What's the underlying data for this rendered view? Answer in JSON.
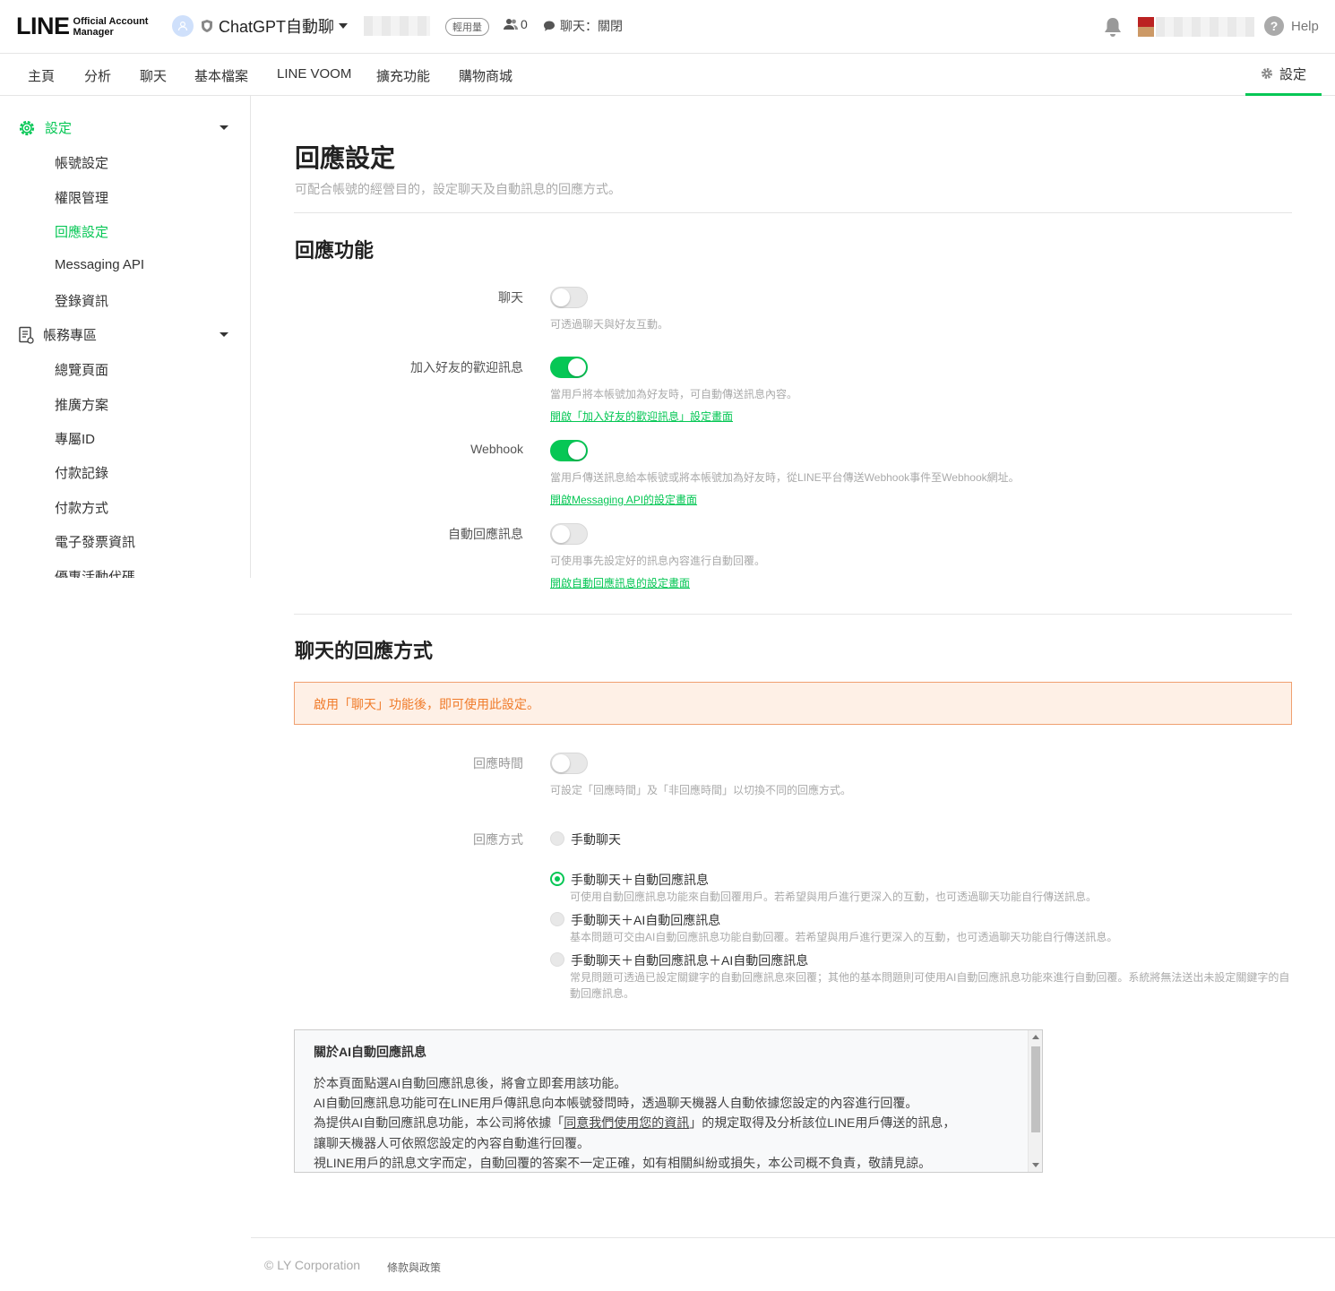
{
  "header": {
    "logo_main": "LINE",
    "logo_sub_1": "Official Account",
    "logo_sub_2": "Manager",
    "account_name": "ChatGPT自動聊",
    "plan_badge": "輕用量",
    "friends_count": "0",
    "chat_status": "聊天：關閉",
    "help_label": "Help"
  },
  "nav": {
    "items": [
      "主頁",
      "分析",
      "聊天",
      "基本檔案",
      "LINE VOOM",
      "擴充功能",
      "購物商城"
    ],
    "settings_label": "設定"
  },
  "sidebar": {
    "group1_label": "設定",
    "group1_items": [
      "帳號設定",
      "權限管理",
      "回應設定",
      "Messaging API",
      "登錄資訊"
    ],
    "group2_label": "帳務專區",
    "group2_items": [
      "總覽頁面",
      "推廣方案",
      "專屬ID",
      "付款記錄",
      "付款方式",
      "電子發票資訊",
      "優惠活動代碼"
    ]
  },
  "main": {
    "title": "回應設定",
    "description": "可配合帳號的經營目的，設定聊天及自動訊息的回應方式。",
    "section1_title": "回應功能",
    "chat_label": "聊天",
    "chat_on": false,
    "chat_help": "可透過聊天與好友互動。",
    "welcome_label": "加入好友的歡迎訊息",
    "welcome_on": true,
    "welcome_help": "當用戶將本帳號加為好友時，可自動傳送訊息內容。",
    "welcome_link": "開啟「加入好友的歡迎訊息」設定畫面",
    "webhook_label": "Webhook",
    "webhook_on": true,
    "webhook_help": "當用戶傳送訊息給本帳號或將本帳號加為好友時，從LINE平台傳送Webhook事件至Webhook網址。",
    "webhook_link": "開啟Messaging API的設定畫面",
    "auto_label": "自動回應訊息",
    "auto_on": false,
    "auto_help": "可使用事先設定好的訊息內容進行自動回覆。",
    "auto_link": "開啟自動回應訊息的設定畫面",
    "section2_title": "聊天的回應方式",
    "notice": "啟用「聊天」功能後，即可使用此設定。",
    "hours_label": "回應時間",
    "hours_on": false,
    "hours_help": "可設定「回應時間」及「非回應時間」以切換不同的回應方式。",
    "method_label": "回應方式",
    "options": [
      {
        "label": "手動聊天",
        "desc": "",
        "selected": false
      },
      {
        "label": "手動聊天＋自動回應訊息",
        "desc": "可使用自動回應訊息功能來自動回覆用戶。若希望與用戶進行更深入的互動，也可透過聊天功能自行傳送訊息。",
        "selected": true
      },
      {
        "label": "手動聊天＋AI自動回應訊息",
        "desc": "基本問題可交由AI自動回應訊息功能自動回覆。若希望與用戶進行更深入的互動，也可透過聊天功能自行傳送訊息。",
        "selected": false
      },
      {
        "label": "手動聊天＋自動回應訊息＋AI自動回應訊息",
        "desc": "常見問題可透過已設定關鍵字的自動回應訊息來回覆；其他的基本問題則可使用AI自動回應訊息功能來進行自動回覆。系統將無法送出未設定關鍵字的自動回應訊息。",
        "selected": false
      }
    ],
    "infobox": {
      "title": "關於AI自動回應訊息",
      "line1": "於本頁面點選AI自動回應訊息後，將會立即套用該功能。",
      "line2": "AI自動回應訊息功能可在LINE用戶傳訊息向本帳號發問時，透過聊天機器人自動依據您設定的內容進行回覆。",
      "line3_pre": "為提供AI自動回應訊息功能，本公司將依據「",
      "line3_link": "同意我們使用您的資訊",
      "line3_post": "」的規定取得及分析該位LINE用戶傳送的訊息，",
      "line4": "讓聊天機器人可依照您設定的內容自動進行回覆。",
      "line5": "視LINE用戶的訊息文字而定，自動回覆的答案不一定正確，如有相關糾紛或損失，本公司概不負責，敬請見諒。"
    }
  },
  "footer": {
    "copyright": "© LY Corporation",
    "terms": "條款與政策"
  },
  "colors": {
    "accent": "#06c755",
    "notice_bg": "#fef0e6",
    "notice_text": "#f07b2a"
  },
  "icons": [
    "user-avatar-icon",
    "shield-icon",
    "caret-down-icon",
    "friends-icon",
    "chat-bubble-icon",
    "bell-icon",
    "help-icon",
    "gear-icon",
    "document-icon"
  ]
}
